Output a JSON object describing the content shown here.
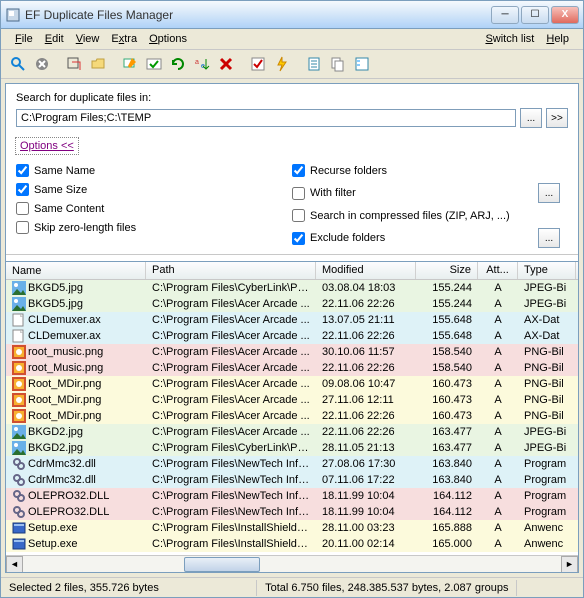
{
  "title": "EF Duplicate Files Manager",
  "menu": {
    "file": "File",
    "edit": "Edit",
    "view": "View",
    "extra": "Extra",
    "options": "Options",
    "switchlist": "Switch list",
    "help": "Help"
  },
  "search": {
    "label": "Search for duplicate files in:",
    "path": "C:\\Program Files;C:\\TEMP",
    "optionsLink": "Options  <<"
  },
  "checksLeft": [
    {
      "label": "Same Name",
      "checked": true
    },
    {
      "label": "Same Size",
      "checked": true
    },
    {
      "label": "Same Content",
      "checked": false
    },
    {
      "label": "Skip zero-length files",
      "checked": false
    }
  ],
  "checksRight": [
    {
      "label": "Recurse folders",
      "checked": true,
      "btn": false
    },
    {
      "label": "With filter",
      "checked": false,
      "btn": true
    },
    {
      "label": "Search in compressed files (ZIP, ARJ, ...)",
      "checked": false,
      "btn": false
    },
    {
      "label": "Exclude folders",
      "checked": true,
      "btn": true
    }
  ],
  "columns": {
    "name": "Name",
    "path": "Path",
    "modified": "Modified",
    "size": "Size",
    "attr": "Att...",
    "type": "Type"
  },
  "rows": [
    {
      "c": "green",
      "icon": "jpg",
      "name": "BKGD5.jpg",
      "path": "C:\\Program Files\\CyberLink\\Po...",
      "mod": "03.08.04  18:03",
      "size": "155.244",
      "attr": "A",
      "type": "JPEG-Bi"
    },
    {
      "c": "green",
      "icon": "jpg",
      "name": "BKGD5.jpg",
      "path": "C:\\Program Files\\Acer Arcade ...",
      "mod": "22.11.06  22:26",
      "size": "155.244",
      "attr": "A",
      "type": "JPEG-Bi"
    },
    {
      "c": "blue",
      "icon": "ax",
      "name": "CLDemuxer.ax",
      "path": "C:\\Program Files\\Acer Arcade ...",
      "mod": "13.07.05  21:11",
      "size": "155.648",
      "attr": "A",
      "type": "AX-Dat"
    },
    {
      "c": "blue",
      "icon": "ax",
      "name": "CLDemuxer.ax",
      "path": "C:\\Program Files\\Acer Arcade ...",
      "mod": "22.11.06  22:26",
      "size": "155.648",
      "attr": "A",
      "type": "AX-Dat"
    },
    {
      "c": "pink",
      "icon": "png",
      "name": "root_music.png",
      "path": "C:\\Program Files\\Acer Arcade ...",
      "mod": "30.10.06  11:57",
      "size": "158.540",
      "attr": "A",
      "type": "PNG-Bil"
    },
    {
      "c": "pink",
      "icon": "png",
      "name": "root_Music.png",
      "path": "C:\\Program Files\\Acer Arcade ...",
      "mod": "22.11.06  22:26",
      "size": "158.540",
      "attr": "A",
      "type": "PNG-Bil"
    },
    {
      "c": "yellow",
      "icon": "png",
      "name": "Root_MDir.png",
      "path": "C:\\Program Files\\Acer Arcade ...",
      "mod": "09.08.06  10:47",
      "size": "160.473",
      "attr": "A",
      "type": "PNG-Bil"
    },
    {
      "c": "yellow",
      "icon": "png",
      "name": "Root_MDir.png",
      "path": "C:\\Program Files\\Acer Arcade ...",
      "mod": "27.11.06  12:11",
      "size": "160.473",
      "attr": "A",
      "type": "PNG-Bil"
    },
    {
      "c": "yellow",
      "icon": "png",
      "name": "Root_MDir.png",
      "path": "C:\\Program Files\\Acer Arcade ...",
      "mod": "22.11.06  22:26",
      "size": "160.473",
      "attr": "A",
      "type": "PNG-Bil"
    },
    {
      "c": "green",
      "icon": "jpg",
      "name": "BKGD2.jpg",
      "path": "C:\\Program Files\\Acer Arcade ...",
      "mod": "22.11.06  22:26",
      "size": "163.477",
      "attr": "A",
      "type": "JPEG-Bi"
    },
    {
      "c": "green",
      "icon": "jpg",
      "name": "BKGD2.jpg",
      "path": "C:\\Program Files\\CyberLink\\Po...",
      "mod": "28.11.05  21:13",
      "size": "163.477",
      "attr": "A",
      "type": "JPEG-Bi"
    },
    {
      "c": "blue",
      "icon": "dll",
      "name": "CdrMmc32.dll",
      "path": "C:\\Program Files\\NewTech Info...",
      "mod": "27.08.06  17:30",
      "size": "163.840",
      "attr": "A",
      "type": "Program"
    },
    {
      "c": "blue",
      "icon": "dll",
      "name": "CdrMmc32.dll",
      "path": "C:\\Program Files\\NewTech Info...",
      "mod": "07.11.06  17:22",
      "size": "163.840",
      "attr": "A",
      "type": "Program"
    },
    {
      "c": "pink",
      "icon": "dll",
      "name": "OLEPRO32.DLL",
      "path": "C:\\Program Files\\NewTech Info...",
      "mod": "18.11.99  10:04",
      "size": "164.112",
      "attr": "A",
      "type": "Program"
    },
    {
      "c": "pink",
      "icon": "dll",
      "name": "OLEPRO32.DLL",
      "path": "C:\\Program Files\\NewTech Info...",
      "mod": "18.11.99  10:04",
      "size": "164.112",
      "attr": "A",
      "type": "Program"
    },
    {
      "c": "yellow",
      "icon": "exe",
      "name": "Setup.exe",
      "path": "C:\\Program Files\\InstallShield I...",
      "mod": "28.11.00  03:23",
      "size": "165.888",
      "attr": "A",
      "type": "Anwenc"
    },
    {
      "c": "yellow",
      "icon": "exe",
      "name": "Setup.exe",
      "path": "C:\\Program Files\\InstallShield I...",
      "mod": "20.11.00  02:14",
      "size": "165.000",
      "attr": "A",
      "type": "Anwenc"
    }
  ],
  "status": {
    "left": "Selected 2 files, 355.726 bytes",
    "right": "Total 6.750 files, 248.385.537 bytes, 2.087 groups"
  }
}
